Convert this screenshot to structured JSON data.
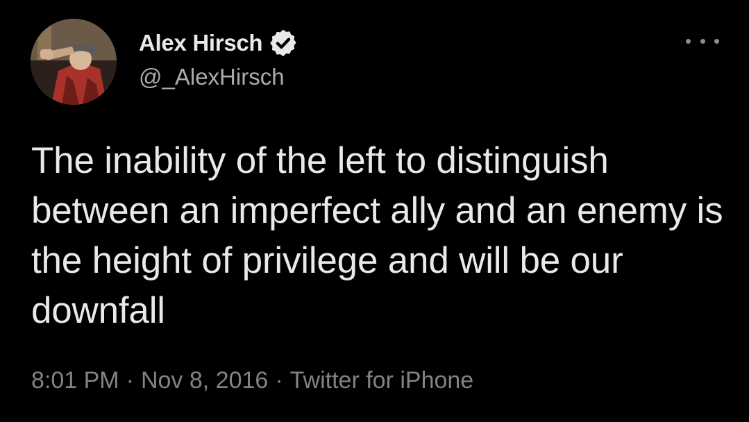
{
  "tweet": {
    "author": {
      "display_name": "Alex Hirsch",
      "handle": "@_AlexHirsch",
      "verified": true,
      "avatar_icon": "profile-photo"
    },
    "text": "The inability of the left to distinguish between an imperfect ally and an enemy is the height of privilege and will be our downfall",
    "time": "8:01 PM",
    "date": "Nov 8, 2016",
    "source": "Twitter for iPhone",
    "separator": "·",
    "more_icon": "more-horizontal-icon"
  },
  "colors": {
    "background": "#000000",
    "primary_text": "#e7e9ea",
    "secondary_text": "#7f8489",
    "verified_badge": "#e7e9ea"
  }
}
